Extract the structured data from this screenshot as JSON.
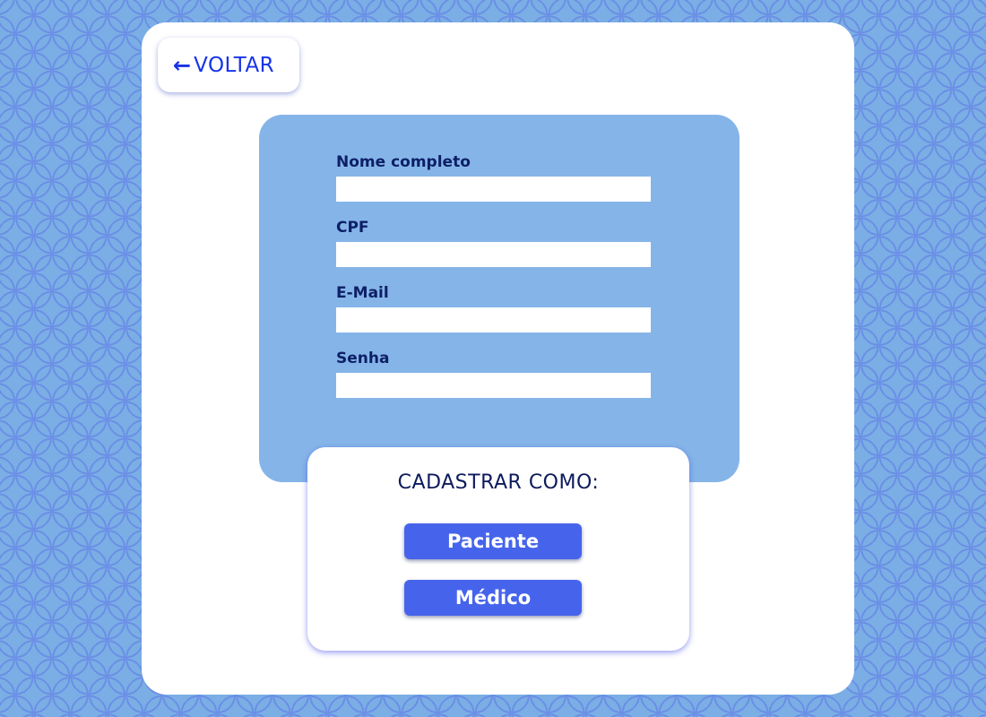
{
  "back_button": {
    "arrow": "←",
    "label": "VOLTAR"
  },
  "form": {
    "fields": [
      {
        "label": "Nome completo",
        "value": ""
      },
      {
        "label": "CPF",
        "value": ""
      },
      {
        "label": "E-Mail",
        "value": ""
      },
      {
        "label": "Senha",
        "value": ""
      }
    ]
  },
  "register": {
    "title": "CADASTRAR COMO:",
    "options": [
      {
        "label": "Paciente"
      },
      {
        "label": "Médico"
      }
    ]
  },
  "colors": {
    "background": "#7aaee4",
    "panel": "#85b5e8",
    "accent": "#4664eb",
    "link": "#1733e8",
    "text_dark": "#0d1f66"
  }
}
